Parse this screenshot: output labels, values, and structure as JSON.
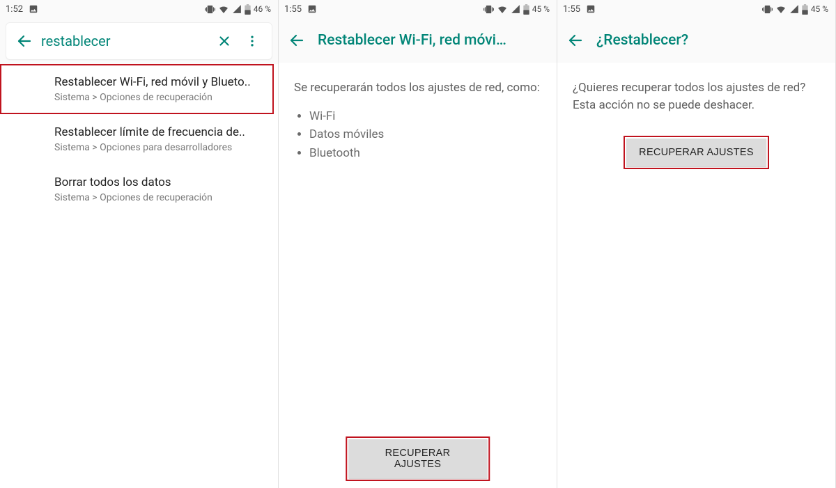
{
  "screen1": {
    "status": {
      "time": "1:52",
      "battery": "46 %"
    },
    "search_query": "restablecer",
    "results": [
      {
        "title": "Restablecer Wi-Fi, red móvil y Blueto..",
        "sub": "Sistema > Opciones de recuperación",
        "highlight": true
      },
      {
        "title": "Restablecer límite de frecuencia de..",
        "sub": "Sistema > Opciones para desarrolladores",
        "highlight": false
      },
      {
        "title": "Borrar todos los datos",
        "sub": "Sistema > Opciones de recuperación",
        "highlight": false
      }
    ]
  },
  "screen2": {
    "status": {
      "time": "1:55",
      "battery": "45 %"
    },
    "title": "Restablecer Wi-Fi, red móvi…",
    "intro": "Se recuperarán todos los ajustes de red, como:",
    "bullets": [
      "Wi-Fi",
      "Datos móviles",
      "Bluetooth"
    ],
    "button": "RECUPERAR AJUSTES"
  },
  "screen3": {
    "status": {
      "time": "1:55",
      "battery": "45 %"
    },
    "title": "¿Restablecer?",
    "body": "¿Quieres recuperar todos los ajustes de red? Esta acción no se puede deshacer.",
    "button": "RECUPERAR AJUSTES"
  },
  "icons": {
    "back": "arrow-left",
    "clear": "close",
    "menu": "more-vert",
    "image": "image",
    "vibrate": "vibrate",
    "wifi": "wifi",
    "signal": "signal",
    "battery": "battery"
  }
}
